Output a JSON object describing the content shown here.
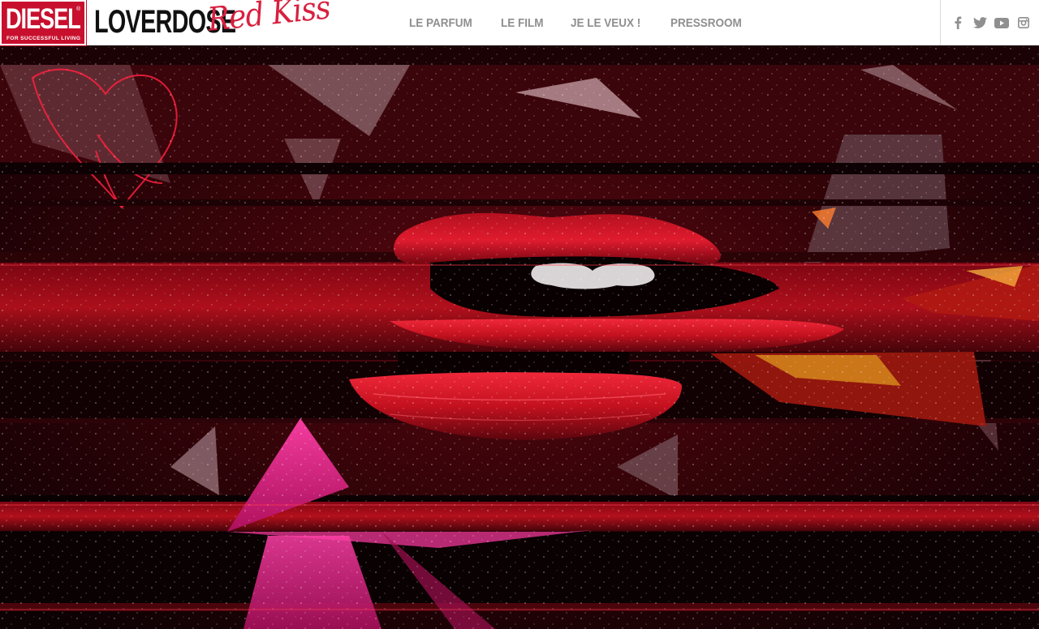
{
  "header": {
    "brand": {
      "name": "DIESEL",
      "registered": "®",
      "tagline": "FOR SUCCESSFUL LIVING"
    },
    "product": {
      "name": "LOVERDOSE",
      "script": "Red Kiss"
    },
    "nav": {
      "items": [
        {
          "label": "LE PARFUM"
        },
        {
          "label": "LE FILM"
        },
        {
          "label": "JE LE VEUX !"
        },
        {
          "label": "PRESSROOM"
        }
      ]
    },
    "social": [
      "facebook-icon",
      "twitter-icon",
      "youtube-icon",
      "instagram-icon"
    ]
  },
  "hero": {
    "content": "glitched red lips visual with triangles"
  },
  "colors": {
    "brand_red": "#c8102e",
    "nav_gray": "#8f8f8f",
    "script_pink": "#d8203f"
  }
}
